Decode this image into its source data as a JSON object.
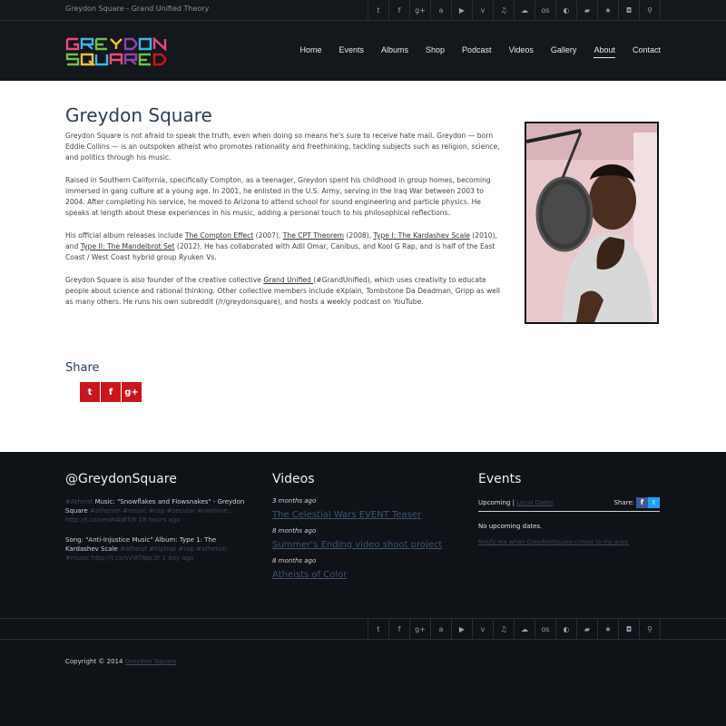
{
  "topbar": {
    "tagline": "Greydon Square - Grand Unified Theory"
  },
  "social_icons": [
    {
      "name": "twitter-icon",
      "glyph": "t"
    },
    {
      "name": "facebook-icon",
      "glyph": "f"
    },
    {
      "name": "googleplus-icon",
      "glyph": "g+"
    },
    {
      "name": "amazon-icon",
      "glyph": "a"
    },
    {
      "name": "youtube-icon",
      "glyph": "▶"
    },
    {
      "name": "vimeo-icon",
      "glyph": "v"
    },
    {
      "name": "music-icon",
      "glyph": "♫"
    },
    {
      "name": "soundcloud-icon",
      "glyph": "☁"
    },
    {
      "name": "lastfm-icon",
      "glyph": "os"
    },
    {
      "name": "bandcamp-icon",
      "glyph": "◐"
    },
    {
      "name": "flag-icon",
      "glyph": "▰"
    },
    {
      "name": "star-icon",
      "glyph": "★"
    },
    {
      "name": "instagram-icon",
      "glyph": "◘"
    },
    {
      "name": "search-icon",
      "glyph": "⚲"
    }
  ],
  "nav": [
    {
      "label": "Home",
      "active": false
    },
    {
      "label": "Events",
      "active": false
    },
    {
      "label": "Albums",
      "active": false
    },
    {
      "label": "Shop",
      "active": false
    },
    {
      "label": "Podcast",
      "active": false
    },
    {
      "label": "Videos",
      "active": false
    },
    {
      "label": "Gallery",
      "active": false
    },
    {
      "label": "About",
      "active": true
    },
    {
      "label": "Contact",
      "active": false
    }
  ],
  "main": {
    "title": "Greydon Square",
    "p1": "Greydon Square is not afraid to speak the truth, even when doing so means he's sure to receive hate mail. Greydon — born Eddie Collins — is an outspoken atheist who promotes rationality and freethinking, tackling subjects such as religion, science, and politics through his music.",
    "p2": "Raised in Southern California, specifically Compton, as a teenager, Greydon spent his childhood in group homes, becoming immersed in gang culture at a young age. In 2001, he enlisted in the U.S. Army, serving in the Iraq War between 2003 to 2004. After completing his service, he moved to Arizona to attend school for sound engineering and particle physics. He speaks at length about these experiences in his music, adding a personal touch to his philosophical reflections.",
    "p3": {
      "t0": "His official album releases include ",
      "l1": "The Compton Effect",
      "t1": " (2007), ",
      "l2": "The CPT Theorem",
      "t2": " (2008), ",
      "l3": "Type I: The Kardashev Scale",
      "t3": " (2010), and ",
      "l4": "Type II: The Mandelbrot Set",
      "t4": " (2012). He has collaborated with Adil Omar, Canibus, and Kool G Rap, and is half of the East Coast / West Coast hybrid group Ryuken Vs."
    },
    "p4": {
      "t0": "Greydon Square is also founder of the creative collective ",
      "l1": "Grand Unified ",
      "t1": "(#GrandUnified), which uses creativity to educate people about science and rational thinking. Other collective members include eXplain, Tombstone Da Deadman, Gripp as well as many others. He runs his own subreddit (/r/greydonsquare), and hosts a weekly podcast on YouTube."
    },
    "share_title": "Share",
    "share_buttons": [
      {
        "name": "share-twitter-button",
        "glyph": "t"
      },
      {
        "name": "share-facebook-button",
        "glyph": "f"
      },
      {
        "name": "share-googleplus-button",
        "glyph": "g+"
      }
    ]
  },
  "footer": {
    "twitter": {
      "title": "@GreydonSquare",
      "tweets": [
        {
          "pre": "#Atheist",
          "text": " Music: \"Snowflakes and Flowsnakes\" - Greydon Square ",
          "tags": "#atheism #music #rap #secular #onelove... http://t.co/ven84b8Tj6 18 hours ago"
        },
        {
          "pre": "",
          "text": "Song: \"Anti-Injustice Music\" Album: Type 1: The Kardashev Scale ",
          "tags": "#atheist #hiphop #rap #atheism #music http://t.co/sViAT6pc3t 1 day ago"
        }
      ]
    },
    "videos": {
      "title": "Videos",
      "items": [
        {
          "date": "3 months ago",
          "title": "The Celestial Wars EVENT Teaser"
        },
        {
          "date": "8 months ago",
          "title": "Summer's Ending video shoot project"
        },
        {
          "date": "8 months ago",
          "title": "Atheists of Color"
        }
      ]
    },
    "events": {
      "title": "Events",
      "upcoming": "Upcoming",
      "sep": " | ",
      "local": "Local Dates",
      "share": "Share:",
      "none": "No upcoming dates.",
      "notify": "Notify me when GreydonSquare comes to my area."
    },
    "copyright": "Copyright © 2014 ",
    "copyright_link": "Greydon Square"
  },
  "colors": {
    "accent_red": "#c8161d",
    "heading_blue": "#2c3e55",
    "dark_bg": "#0f1217"
  }
}
